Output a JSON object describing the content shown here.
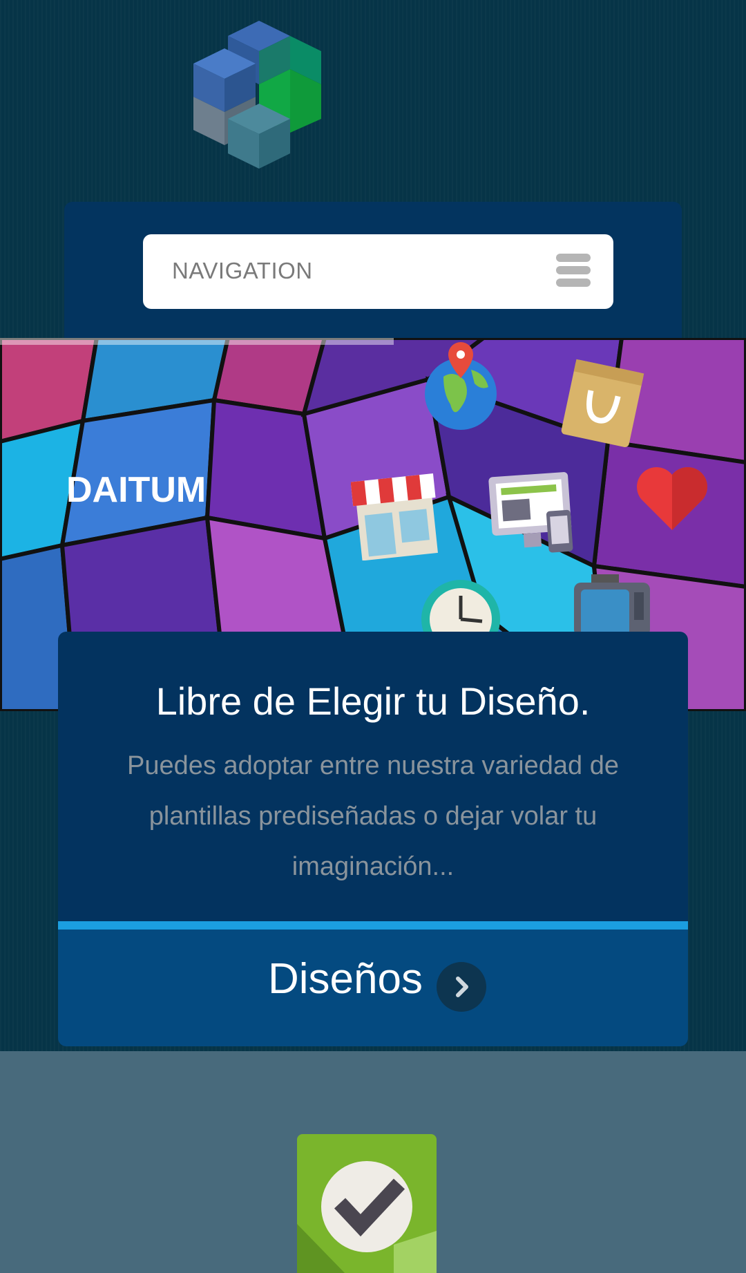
{
  "header": {
    "logo_icon": "cube-logo-icon"
  },
  "navigation": {
    "label": "NAVIGATION",
    "menu_icon": "hamburger-menu-icon"
  },
  "hero": {
    "title": "DAITUM",
    "decor_icons": [
      "globe-pin-icon",
      "shopping-bag-icon",
      "storefront-icon",
      "devices-icon",
      "heart-icon",
      "clock-icon",
      "tv-icon"
    ]
  },
  "feature_card": {
    "title": "Libre de Elegir tu Diseño.",
    "description": "Puedes adoptar entre nuestra variedad de plantillas prediseñadas o dejar volar tu imaginación...",
    "button_label": "Diseños",
    "button_icon": "chevron-right-icon"
  },
  "lower_section": {
    "icon": "checkmark-badge-icon"
  },
  "colors": {
    "background": "#063447",
    "nav_panel": "#03345f",
    "card": "#03335f",
    "card_button": "#044a80",
    "accent": "#1b9ee0",
    "lower_section": "#486a7c"
  }
}
